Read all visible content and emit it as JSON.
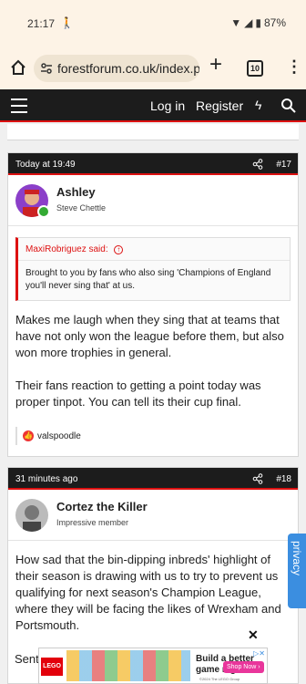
{
  "status_bar": {
    "time": "21:17",
    "battery": "87%"
  },
  "browser": {
    "url": "forestforum.co.uk/index.ph",
    "tab_count": "10"
  },
  "site_nav": {
    "login": "Log in",
    "register": "Register"
  },
  "posts": [
    {
      "time": "Today at 19:49",
      "number": "#17",
      "user": "Ashley",
      "user_title": "Steve Chettle",
      "quote_author": "MaxiRobriguez said:",
      "quote_text": "Brought to you by fans who also sing 'Champions of England you'll never sing that' at us.",
      "message_p1": "Makes me laugh when they sing that at teams that have not only won the league before them, but also won more trophies in general.",
      "message_p2": "Their fans reaction to getting a point today was proper tinpot. You can tell its their cup final.",
      "reaction_user": "valspoodle"
    },
    {
      "time": "31 minutes ago",
      "number": "#18",
      "user": "Cortez the Killer",
      "user_title": "Impressive member",
      "message_p1": "How sad that the bin-dipping inbreds' highlight of their season is drawing with us to try to prevent us qualifying for next season's Champion League, where they will be facing the likes of Wrexham and Portsmouth.",
      "message_partial": "Sent"
    }
  ],
  "privacy_tab": "privacy",
  "ad": {
    "brand": "LEGO",
    "headline": "Build a better game night",
    "cta": "Shop Now ›",
    "fine_print": "©2024 The LEGO Group"
  },
  "colors": {
    "accent_red": "#d11",
    "nav_dark": "#1c1c1c",
    "chrome_bg": "#fdf3e6",
    "privacy_blue": "#3b8ee0"
  }
}
